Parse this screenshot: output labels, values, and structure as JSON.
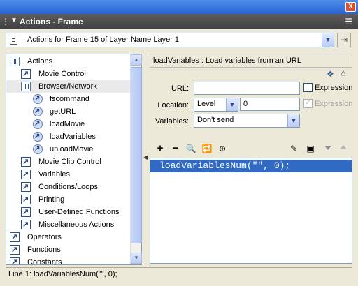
{
  "window": {
    "close_glyph": "X",
    "panel_title": "Actions - Frame",
    "menu_icon": "options-menu-icon"
  },
  "target": {
    "label": "Actions for Frame 15 of Layer Name Layer 1"
  },
  "tree": {
    "items": [
      {
        "label": "Actions",
        "icon": "book-open-icon"
      },
      {
        "label": "Movie Control",
        "icon": "book-icon"
      },
      {
        "label": "Browser/Network",
        "icon": "book-open-icon"
      },
      {
        "label": "fscommand",
        "icon": "action-icon"
      },
      {
        "label": "getURL",
        "icon": "action-icon"
      },
      {
        "label": "loadMovie",
        "icon": "action-icon"
      },
      {
        "label": "loadVariables",
        "icon": "action-icon"
      },
      {
        "label": "unloadMovie",
        "icon": "action-icon"
      },
      {
        "label": "Movie Clip Control",
        "icon": "book-icon"
      },
      {
        "label": "Variables",
        "icon": "book-icon"
      },
      {
        "label": "Conditions/Loops",
        "icon": "book-icon"
      },
      {
        "label": "Printing",
        "icon": "book-icon"
      },
      {
        "label": "User-Defined Functions",
        "icon": "book-icon"
      },
      {
        "label": "Miscellaneous Actions",
        "icon": "book-icon"
      },
      {
        "label": "Operators",
        "icon": "book-icon"
      },
      {
        "label": "Functions",
        "icon": "book-icon"
      },
      {
        "label": "Constants",
        "icon": "book-icon"
      }
    ]
  },
  "params": {
    "header": "loadVariables : Load variables from an URL",
    "url_label": "URL:",
    "url_value": "",
    "url_expression": "Expression",
    "location_label": "Location:",
    "location_select": "Level",
    "location_value": "0",
    "location_expression": "Expression",
    "variables_label": "Variables:",
    "variables_select": "Don't send"
  },
  "toolbar": {
    "add": "+",
    "remove": "−"
  },
  "script": {
    "line1": "loadVariablesNum(\"\", 0);"
  },
  "status": {
    "text": "Line 1: loadVariablesNum(\"\", 0);"
  }
}
